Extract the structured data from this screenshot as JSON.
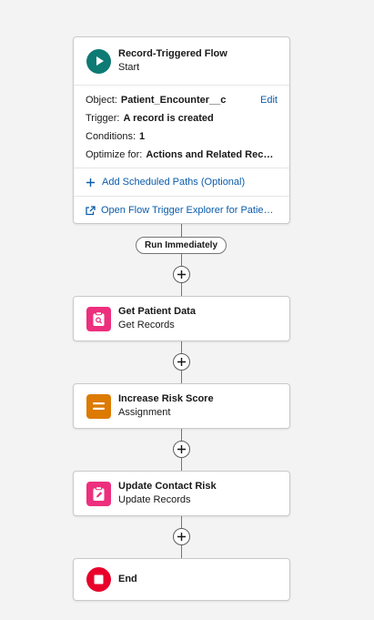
{
  "start": {
    "title": "Record-Triggered Flow",
    "subtitle": "Start",
    "icon": "play-icon",
    "icon_color": "#0d7a74",
    "object_label": "Object:",
    "object_value": "Patient_Encounter__c",
    "edit_label": "Edit",
    "trigger_label": "Trigger:",
    "trigger_value": "A record is created",
    "conditions_label": "Conditions:",
    "conditions_value": "1",
    "optimize_label": "Optimize for:",
    "optimize_value": "Actions and Related Records",
    "scheduled_paths_link": "Add Scheduled Paths (Optional)",
    "explorer_link": "Open Flow Trigger Explorer for Patient_Encounter__c"
  },
  "path_label": "Run Immediately",
  "elements": [
    {
      "title": "Get Patient Data",
      "subtitle": "Get Records",
      "icon": "get-records-icon",
      "color": "#ed2f7d"
    },
    {
      "title": "Increase Risk Score",
      "subtitle": "Assignment",
      "icon": "assignment-icon",
      "color": "#dd7a01"
    },
    {
      "title": "Update Contact Risk",
      "subtitle": "Update Records",
      "icon": "update-records-icon",
      "color": "#ed2f7d"
    }
  ],
  "end": {
    "title": "End",
    "icon": "stop-icon",
    "color": "#e8012a"
  }
}
